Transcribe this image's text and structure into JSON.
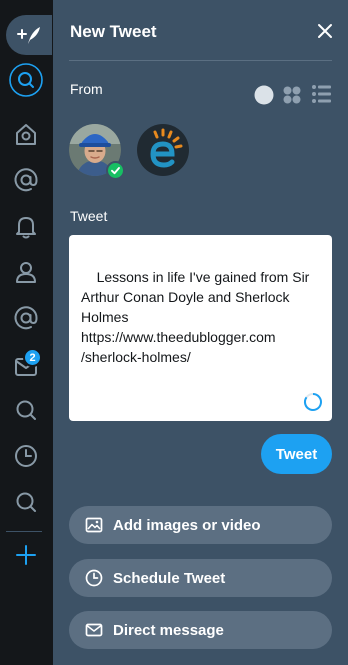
{
  "header": {
    "title": "New Tweet",
    "close_icon": "close-icon"
  },
  "from": {
    "label": "From",
    "view_options": [
      "circle-view-icon",
      "grid-view-icon",
      "list-view-icon"
    ]
  },
  "accounts": [
    {
      "name": "account-avatar-1",
      "selected": true
    },
    {
      "name": "account-avatar-2-edublogger-logo",
      "selected": false
    }
  ],
  "tweet": {
    "label": "Tweet",
    "text": "Lessons in life I've gained from Sir Arthur Conan Doyle and Sherlock Holmes https://www.theedublogger.com /sherlock-holmes/",
    "button_label": "Tweet"
  },
  "actions": {
    "add_media_label": "Add images or video",
    "schedule_label": "Schedule Tweet",
    "dm_label": "Direct message"
  },
  "sidebar": {
    "badge_count": "2",
    "items": [
      "compose-icon",
      "search-icon",
      "home-icon",
      "mentions-icon",
      "notifications-icon",
      "user-icon",
      "mentions-icon",
      "messages-icon",
      "search-icon",
      "scheduled-icon",
      "search-icon",
      "add-column-icon"
    ]
  },
  "colors": {
    "accent": "#1da1f2",
    "panel_bg": "#3d5266",
    "rail_bg": "#14171a",
    "button_bg": "#5c6f82",
    "success": "#17bf63"
  }
}
